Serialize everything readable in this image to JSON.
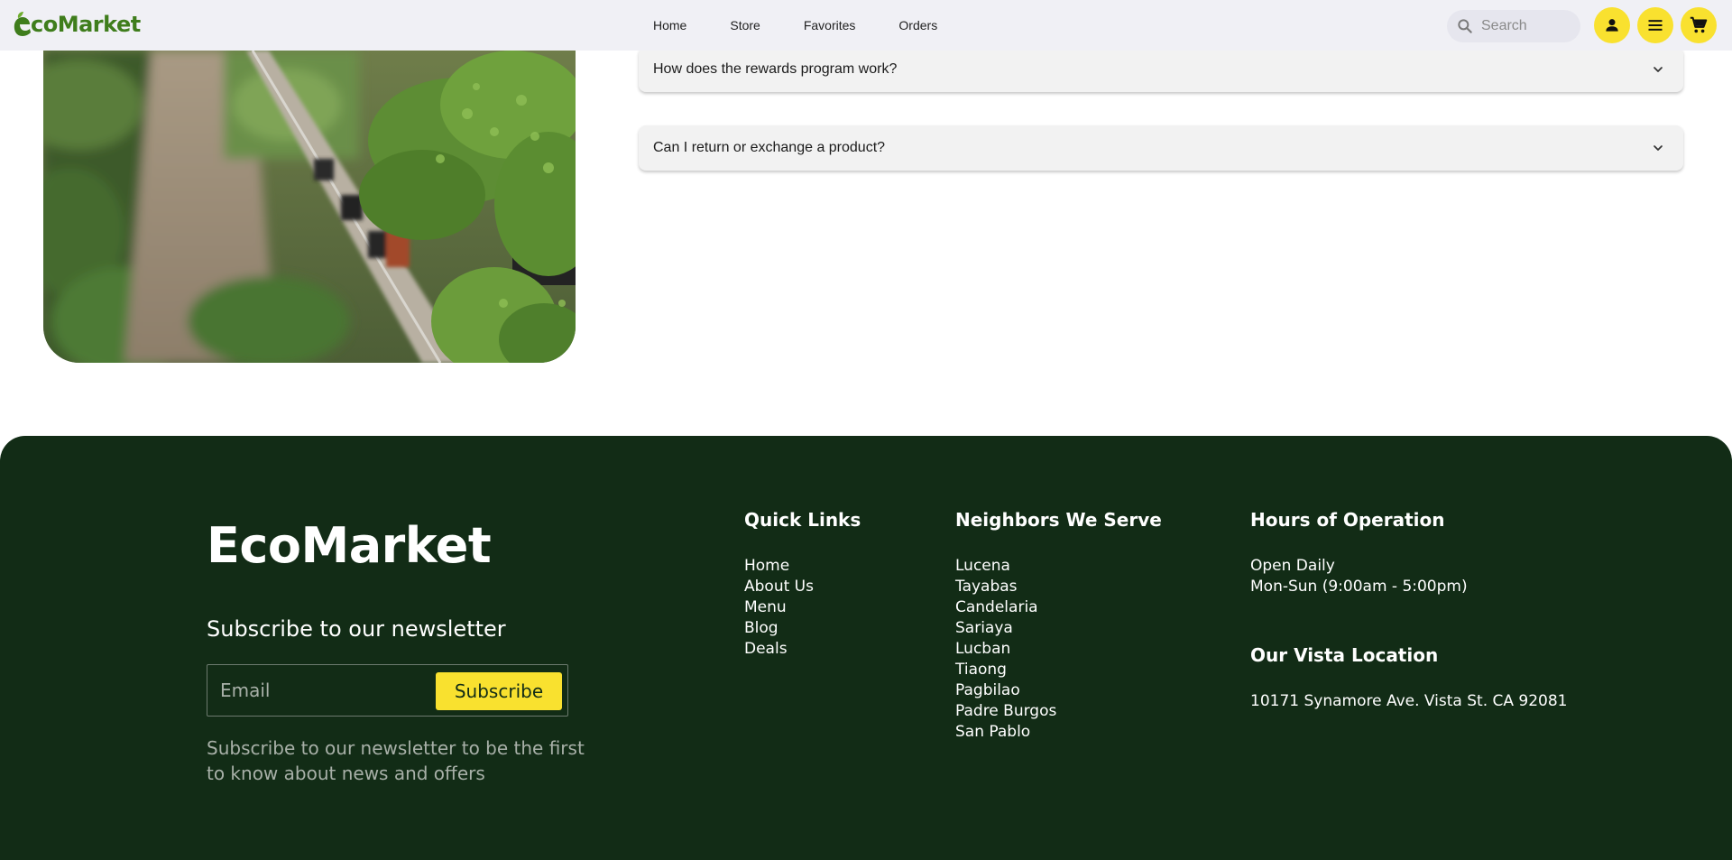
{
  "header": {
    "logo_text": "coMarket",
    "nav": [
      "Home",
      "Store",
      "Favorites",
      "Orders"
    ],
    "search_placeholder": "Search",
    "icons": [
      "account-icon",
      "menu-icon",
      "cart-icon"
    ],
    "accent_color": "#f9e12f"
  },
  "faq": [
    {
      "question": "How does the rewards program work?"
    },
    {
      "question": "Can I return or exchange a product?"
    }
  ],
  "footer": {
    "brand": "EcoMarket",
    "newsletter_title": "Subscribe to our newsletter",
    "email_placeholder": "Email",
    "subscribe_label": "Subscribe",
    "newsletter_note": "Subscribe to our newsletter to be the first to know about news and offers",
    "quick_links": {
      "title": "Quick Links",
      "items": [
        "Home",
        "About Us",
        "Menu",
        "Blog",
        "Deals"
      ]
    },
    "neighbors": {
      "title": "Neighbors We Serve",
      "items": [
        "Lucena",
        "Tayabas",
        "Candelaria",
        "Sariaya",
        "Lucban",
        "Tiaong",
        "Pagbilao",
        "Padre Burgos",
        "San Pablo"
      ]
    },
    "hours": {
      "title": "Hours of Operation",
      "line1": "Open Daily",
      "line2": "Mon-Sun (9:00am - 5:00pm)"
    },
    "location": {
      "title": "Our Vista Location",
      "address": "10171 Synamore Ave. Vista St. CA 92081"
    },
    "background_color": "#122c16"
  }
}
